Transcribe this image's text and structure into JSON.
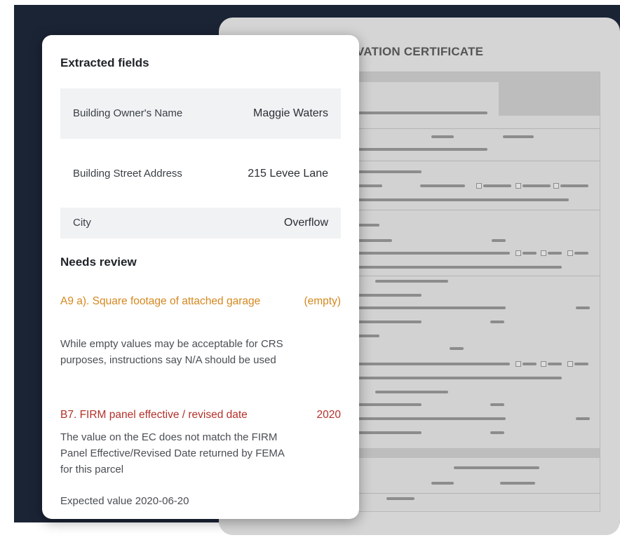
{
  "document": {
    "title": "VATION CERTIFICATE"
  },
  "panel": {
    "extracted_heading": "Extracted fields",
    "fields": [
      {
        "label": "Building Owner's Name",
        "value": "Maggie Waters"
      },
      {
        "label": "Building Street Address",
        "value": "215 Levee Lane"
      },
      {
        "label": "City",
        "value": "Overflow"
      }
    ],
    "review_heading": "Needs review",
    "issues": [
      {
        "title": "A9 a). Square footage of attached garage",
        "value": "(empty)",
        "severity_color": "#d48820",
        "description": "While empty values may be acceptable for CRS purposes, instructions say N/A should be used"
      },
      {
        "title": "B7. FIRM panel effective / revised date",
        "value": "2020",
        "severity_color": "#b4302a",
        "description": "The value on the EC does not match the FIRM Panel Effective/Revised Date returned by FEMA for this parcel",
        "expected": "Expected value 2020-06-20"
      }
    ]
  },
  "colors": {
    "backdrop": "#1b2435",
    "panel": "#ffffff",
    "warning": "#d48820",
    "error": "#b4302a"
  }
}
